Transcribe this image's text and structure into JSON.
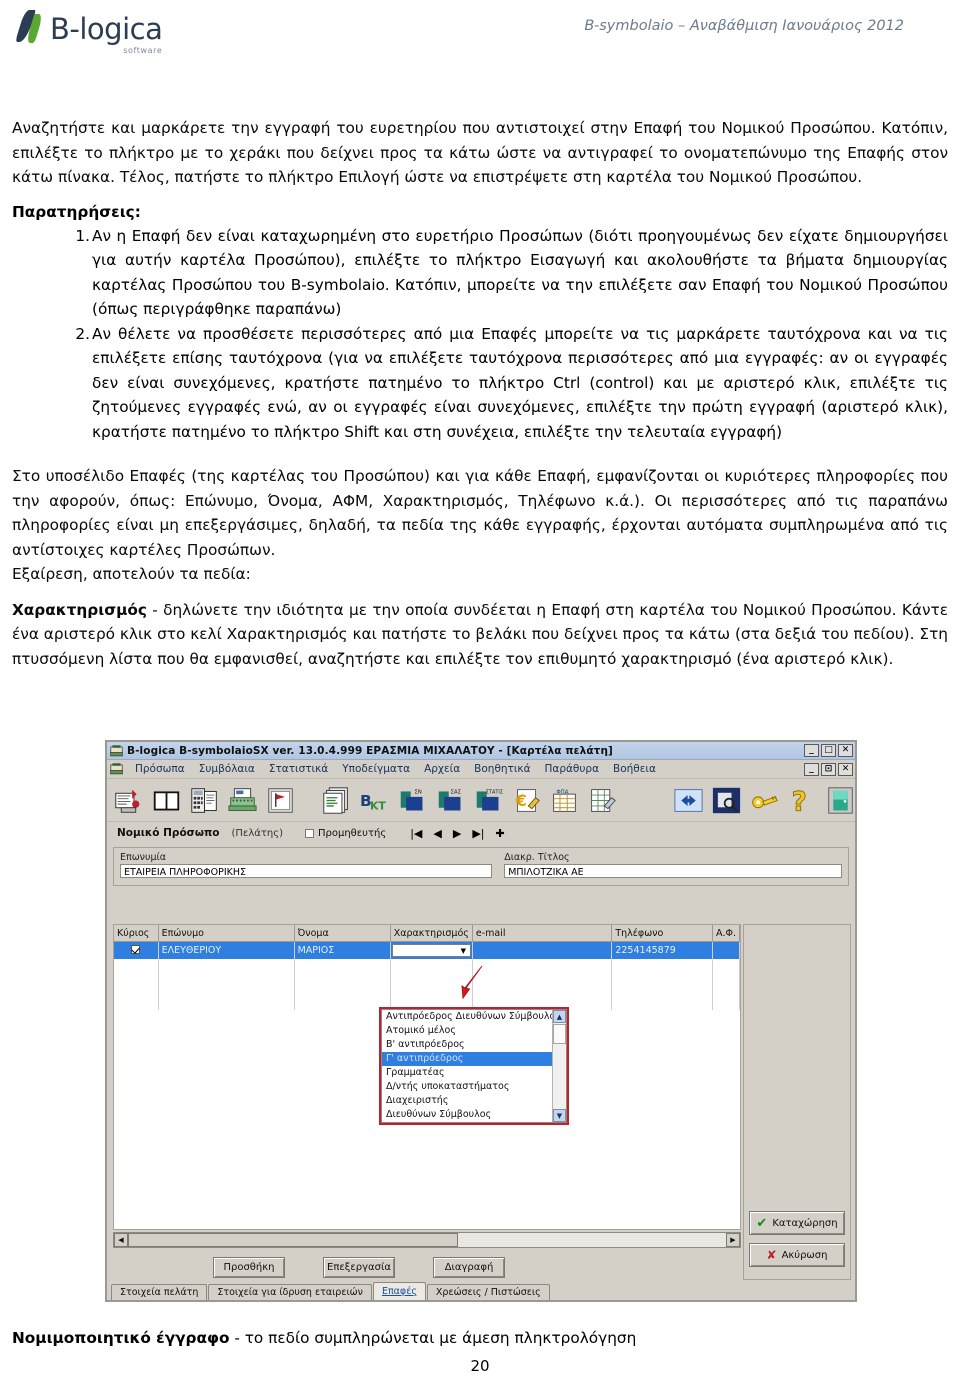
{
  "header": {
    "logo_text": "B-logica",
    "logo_sub": "software",
    "right_text": "B-symbolaio – Αναβάθμιση Ιανουάριος 2012"
  },
  "doc": {
    "para1": "Αναζητήστε και μαρκάρετε την εγγραφή του ευρετηρίου που αντιστοιχεί στην Επαφή του Νομικού Προσώπου. Κατόπιν, επιλέξτε το πλήκτρο με το χεράκι που δείχνει προς τα κάτω ώστε να αντιγραφεί το ονοματεπώνυμο της Επαφής στον κάτω πίνακα. Τέλος, πατήστε το πλήκτρο Επιλογή ώστε να επιστρέψετε στη καρτέλα του Νομικού Προσώπου.",
    "notes_heading": "Παρατηρήσεις:",
    "note1": "Αν η Επαφή δεν είναι καταχωρημένη στο ευρετήριο Προσώπων (διότι προηγουμένως δεν είχατε δημιουργήσει για αυτήν καρτέλα Προσώπου), επιλέξτε το πλήκτρο Εισαγωγή και ακολουθήστε τα βήματα δημιουργίας καρτέλας Προσώπου του B-symbolaio. Κατόπιν, μπορείτε να την επιλέξετε σαν Επαφή του Νομικού Προσώπου (όπως περιγράφθηκε παραπάνω)",
    "note2": "Αν θέλετε να προσθέσετε περισσότερες από μια Επαφές μπορείτε να τις μαρκάρετε ταυτόχρονα και να τις επιλέξετε επίσης ταυτόχρονα (για να επιλέξετε ταυτόχρονα περισσότερες από μια εγγραφές: αν οι εγγραφές δεν είναι συνεχόμενες, κρατήστε πατημένο το πλήκτρο Ctrl (control) και με αριστερό κλικ, επιλέξτε τις ζητούμενες εγγραφές ενώ, αν οι εγγραφές είναι συνεχόμενες, επιλέξτε την πρώτη εγγραφή (αριστερό κλικ), κρατήστε πατημένο το πλήκτρο Shift και στη συνέχεια, επιλέξτε την τελευταία εγγραφή)",
    "para2": "Στο υποσέλιδο Επαφές (της καρτέλας του Προσώπου) και για κάθε Επαφή, εμφανίζονται οι κυριότερες πληροφορίες που την αφορούν, όπως: Επώνυμο, Όνομα, ΑΦΜ, Χαρακτηρισμός, Τηλέφωνο κ.ά.). Οι περισσότερες από τις παραπάνω πληροφορίες είναι μη επεξεργάσιμες, δηλαδή, τα πεδία της κάθε εγγραφής, έρχονται αυτόματα συμπληρωμένα από τις αντίστοιχες καρτέλες Προσώπων.",
    "para3": "Εξαίρεση, αποτελούν τα πεδία:",
    "field1_name": "Χαρακτηρισμός",
    "field1_desc": " - δηλώνετε την ιδιότητα με την οποία συνδέεται η Επαφή στη καρτέλα του Νομικού Προσώπου. Κάντε ένα αριστερό κλικ στο κελί Χαρακτηρισμός και πατήστε το βελάκι που δείχνει προς τα κάτω (στα δεξιά του πεδίου). Στη πτυσσόμενη λίστα που θα εμφανισθεί, αναζητήστε και επιλέξτε τον επιθυμητό χαρακτηρισμό (ένα αριστερό κλικ).",
    "field2_name": "Νομιμοποιητικό έγγραφο",
    "field2_desc": " - το πεδίο συμπληρώνεται με άμεση πληκτρολόγηση",
    "page_number": "20"
  },
  "app": {
    "title": "B-logica    B-symbolaioSX ver. 13.0.4.999   ΕΡΑΣΜΙΑ ΜΙΧΑΛΑΤΟΥ - [Καρτέλα πελάτη]",
    "window_buttons": [
      "_",
      "□",
      "✕"
    ],
    "mdi_buttons": [
      "_",
      "⊡",
      "✕"
    ],
    "menu": [
      "Πρόσωπα",
      "Συμβόλαια",
      "Στατιστικά",
      "Υποδείγματα",
      "Αρχεία",
      "Βοηθητικά",
      "Παράθυρα",
      "Βοήθεια"
    ],
    "nav": {
      "label": "Νομικό Πρόσωπο",
      "sub": "(Πελάτης)",
      "checkbox_label": "Προμηθευτής",
      "buttons": [
        "|◀",
        "◀",
        "▶",
        "▶|",
        "✚"
      ]
    },
    "fields": [
      {
        "label": "Επωνυμία",
        "value": "ΕΤΑΙΡΕΙΑ ΠΛΗΡΟΦΟΡΙΚΗΣ"
      },
      {
        "label": "Διακρ. Τίτλος",
        "value": "ΜΠΙΛΟΤΖΙΚΑ ΑΕ"
      }
    ],
    "grid": {
      "columns": [
        "Κύριος",
        "Επώνυμο",
        "Όνομα",
        "Χαρακτηρισμός",
        "e-mail",
        "Τηλέφωνο",
        "Α.Φ."
      ],
      "row": {
        "checked": true,
        "surname": "ΕΛΕΥΘΕΡΙΟΥ",
        "firstname": "ΜΑΡΙΟΣ",
        "characterization": "",
        "email": "",
        "phone": "2254145879",
        "afm": ""
      }
    },
    "dropdown": {
      "items": [
        "Αντιπρόεδρος Διευθύνων Σύμβουλος",
        "Ατομικό μέλος",
        "Β' αντιπρόεδρος",
        "Γ' αντιπρόεδρος",
        "Γραμματέας",
        "Δ/ντής υποκαταστήματος",
        "Διαχειριστής",
        "Διευθύνων Σύμβουλος"
      ],
      "selected_index": 3,
      "up_arrow": "▲",
      "down_arrow": "▼"
    },
    "action_buttons": [
      "Προσθήκη",
      "Επεξεργασία",
      "Διαγραφή"
    ],
    "tabs": [
      "Στοιχεία πελάτη",
      "Στοιχεία για ίδρυση εταιρειών",
      "Επαφές",
      "Χρεώσεις / Πιστώσεις"
    ],
    "active_tab_index": 2,
    "right_buttons": [
      {
        "label": "Καταχώρηση",
        "icon": "check-icon",
        "color": "#1a8a1a"
      },
      {
        "label": "Ακύρωση",
        "icon": "cross-icon",
        "color": "#c0202a"
      }
    ]
  },
  "colors": {
    "accent_red": "#c0202a",
    "selection_blue": "#2f7fe0",
    "window_chrome": "#d4d0c8",
    "title_blue": "#b0c6e2"
  }
}
